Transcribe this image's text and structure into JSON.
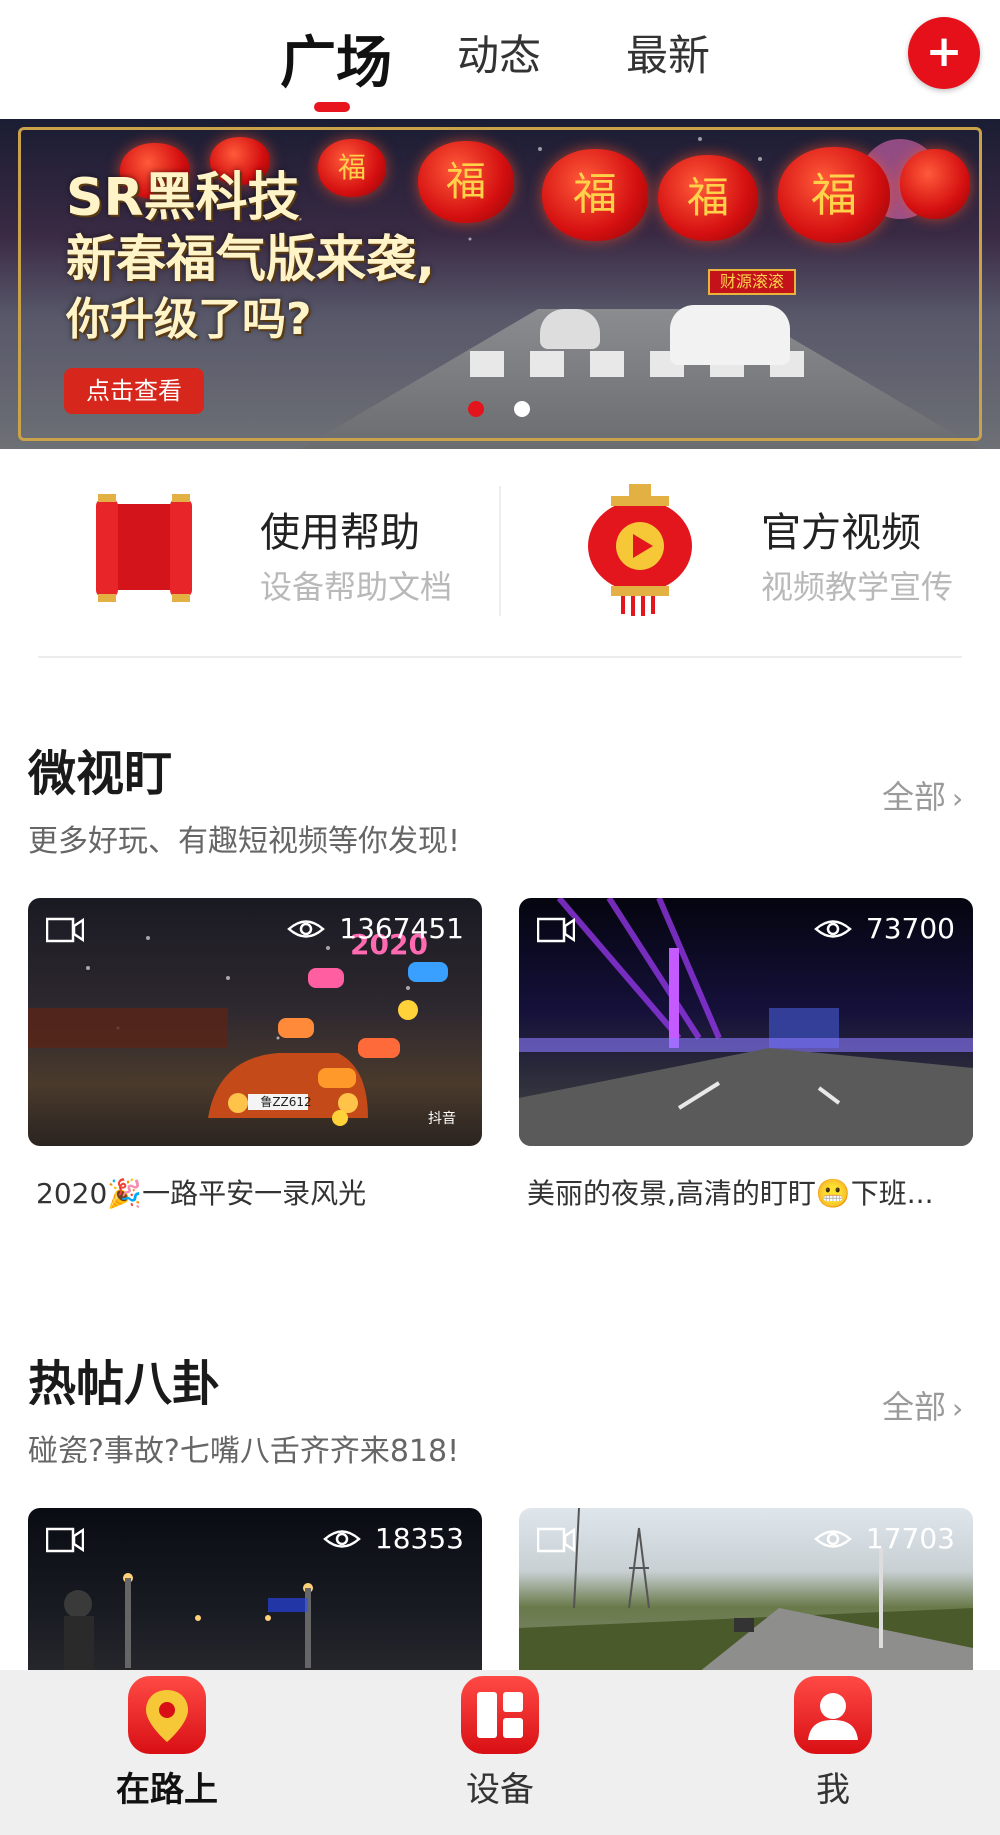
{
  "tabs": [
    {
      "label": "广场",
      "active": true
    },
    {
      "label": "动态",
      "active": false
    },
    {
      "label": "最新",
      "active": false
    }
  ],
  "add_button": {
    "icon": "plus-icon",
    "label": "+"
  },
  "banner": {
    "title_line1": "SR黑科技",
    "title_line2": "新春福气版来袭,",
    "title_line3": "你升级了吗?",
    "button_label": "点击查看",
    "lantern_char": "福",
    "sign_text": "财源滚滚",
    "slide_count": 2,
    "active_slide": 1
  },
  "quick_entries": [
    {
      "title": "使用帮助",
      "subtitle": "设备帮助文档",
      "icon": "scroll-icon"
    },
    {
      "title": "官方视频",
      "subtitle": "视频教学宣传",
      "icon": "lantern-play-icon"
    }
  ],
  "sections": [
    {
      "title": "微视盯",
      "subtitle": "更多好玩、有趣短视频等你发现!",
      "more_label": "全部",
      "cards": [
        {
          "views": "1367451",
          "caption": "2020🎉一路平安一录风光",
          "overlay": "2020",
          "watermark": "抖音",
          "plate": "鲁ZZ612"
        },
        {
          "views": "73700",
          "caption": "美丽的夜景,高清的盯盯😬下班..."
        }
      ]
    },
    {
      "title": "热帖八卦",
      "subtitle": "碰瓷?事故?七嘴八舌齐齐来818!",
      "more_label": "全部",
      "cards": [
        {
          "views": "18353",
          "caption": ""
        },
        {
          "views": "17703",
          "caption": ""
        }
      ]
    }
  ],
  "bottom_nav": [
    {
      "label": "在路上",
      "icon": "location-pin-icon",
      "active": true
    },
    {
      "label": "设备",
      "icon": "device-grid-icon",
      "active": false
    },
    {
      "label": "我",
      "icon": "user-icon",
      "active": false
    }
  ],
  "colors": {
    "accent": "#e5101a",
    "gold": "#c9a24a",
    "muted": "#b9b9b9"
  }
}
